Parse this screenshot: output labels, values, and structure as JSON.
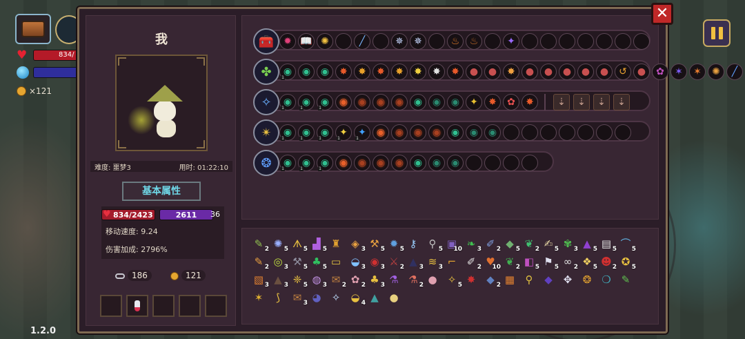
{
  "hud": {
    "hp_text": "834/",
    "coin_count": "×121",
    "version": "1.2.0"
  },
  "character": {
    "name": "我",
    "difficulty": "难度: 噩梦3",
    "time": "用时: 01:22:10",
    "attributes_button": "基本属性",
    "hp": "834/2423",
    "mp": "2611",
    "mp_extra": "36",
    "move_speed": "移动速度: 9.24",
    "damage_bonus": "伤害加成: 2796%",
    "keys": "186",
    "coins": "121"
  },
  "close_label": "✕",
  "colors": {
    "hp": "#a41c2c",
    "mp": "#6a2aa6",
    "panel": "#2b1d28",
    "accent": "#6fd8e8"
  },
  "rows": [
    {
      "icon": "chest-icon",
      "glyph": "🧰",
      "skills": [
        {
          "g": "✹",
          "c": "#e0407a"
        },
        {
          "g": "📖",
          "c": "#9ab8ff"
        },
        {
          "g": "✺",
          "c": "#f0c040"
        },
        {
          "g": "",
          "c": ""
        },
        {
          "g": "╱",
          "c": "#7ab8ff"
        },
        {
          "g": "",
          "c": ""
        },
        {
          "g": "✵",
          "c": "#c8d8ff"
        },
        {
          "g": "✵",
          "c": "#c8d8ff"
        },
        {
          "g": "",
          "c": ""
        },
        {
          "g": "♨",
          "c": "#e8802a"
        },
        {
          "g": "♨",
          "c": "#c8702a"
        },
        {
          "g": "",
          "c": ""
        },
        {
          "g": "✦",
          "c": "#9a6aff"
        },
        {
          "g": "",
          "c": ""
        },
        {
          "g": "",
          "c": ""
        },
        {
          "g": "",
          "c": ""
        },
        {
          "g": "",
          "c": ""
        },
        {
          "g": "",
          "c": ""
        },
        {
          "g": "",
          "c": ""
        },
        {
          "g": "",
          "c": ""
        }
      ]
    },
    {
      "icon": "staff-green-icon",
      "glyph": "✤",
      "skills": [
        {
          "g": "◉",
          "c": "#30c090",
          "lv": "1"
        },
        {
          "g": "◉",
          "c": "#30c090"
        },
        {
          "g": "◉",
          "c": "#30c090"
        },
        {
          "g": "✸",
          "c": "#e85a2a"
        },
        {
          "g": "✸",
          "c": "#e8a02a"
        },
        {
          "g": "✸",
          "c": "#e85a2a"
        },
        {
          "g": "✸",
          "c": "#e8a02a"
        },
        {
          "g": "✸",
          "c": "#f0d040"
        },
        {
          "g": "✸",
          "c": "#e0e0e0"
        },
        {
          "g": "✸",
          "c": "#e85a2a"
        },
        {
          "g": "●",
          "c": "#c85050"
        },
        {
          "g": "●",
          "c": "#c85050"
        },
        {
          "g": "✸",
          "c": "#f0a040"
        },
        {
          "g": "●",
          "c": "#c85050"
        },
        {
          "g": "●",
          "c": "#c85050"
        },
        {
          "g": "●",
          "c": "#c85050"
        },
        {
          "g": "●",
          "c": "#c85050"
        },
        {
          "g": "●",
          "c": "#c85050"
        },
        {
          "g": "↺",
          "c": "#e8a030"
        },
        {
          "g": "●",
          "c": "#c85050"
        },
        {
          "g": "✿",
          "c": "#c050c0"
        },
        {
          "g": "✶",
          "c": "#8060ff"
        },
        {
          "g": "✶",
          "c": "#f08030"
        },
        {
          "g": "✺",
          "c": "#e8a040"
        },
        {
          "g": "╱",
          "c": "#60a0ff"
        }
      ]
    },
    {
      "icon": "staff-blue-icon",
      "glyph": "✧",
      "skills": [
        {
          "g": "◉",
          "c": "#30c090",
          "lv": "1"
        },
        {
          "g": "◉",
          "c": "#30c090",
          "lv": "1"
        },
        {
          "g": "◉",
          "c": "#30c090",
          "lv": "1"
        },
        {
          "g": "((•))",
          "c": "#e8602a"
        },
        {
          "g": "((•))",
          "c": "#a84020"
        },
        {
          "g": "((•))",
          "c": "#a84020"
        },
        {
          "g": "((•))",
          "c": "#a84020"
        },
        {
          "g": "◉",
          "c": "#30c090"
        },
        {
          "g": "◉",
          "c": "#2a8a70"
        },
        {
          "g": "◉",
          "c": "#2a8a70"
        },
        {
          "g": "✦",
          "c": "#e8c030"
        },
        {
          "g": "✸",
          "c": "#e85a2a"
        },
        {
          "g": "✿",
          "c": "#e85050"
        },
        {
          "g": "✸",
          "c": "#e85a2a"
        },
        {
          "sep": true
        },
        {
          "g": "⇣",
          "c": "#c8a090",
          "sq": true
        },
        {
          "g": "⇣",
          "c": "#c8a090",
          "sq": true
        },
        {
          "g": "⇣",
          "c": "#c8a090",
          "sq": true
        },
        {
          "g": "⇣",
          "c": "#c8a090",
          "sq": true
        }
      ]
    },
    {
      "icon": "staff-gold-icon",
      "glyph": "✴",
      "skills": [
        {
          "g": "◉",
          "c": "#30c090",
          "lv": "1"
        },
        {
          "g": "◉",
          "c": "#30c090",
          "lv": "1"
        },
        {
          "g": "◉",
          "c": "#30c090",
          "lv": "1"
        },
        {
          "g": "✦",
          "c": "#f0d040",
          "lv": "1"
        },
        {
          "g": "✦",
          "c": "#40a0ff",
          "lv": "1"
        },
        {
          "g": "((•))",
          "c": "#e8602a"
        },
        {
          "g": "((•))",
          "c": "#a84020"
        },
        {
          "g": "((•))",
          "c": "#a84020"
        },
        {
          "g": "((•))",
          "c": "#a84020"
        },
        {
          "g": "◉",
          "c": "#30c090"
        },
        {
          "g": "◉",
          "c": "#2a8a70"
        },
        {
          "g": "◉",
          "c": "#2a8a70"
        },
        {
          "g": "",
          "c": ""
        },
        {
          "g": "",
          "c": ""
        },
        {
          "g": "",
          "c": ""
        },
        {
          "g": "",
          "c": ""
        },
        {
          "g": "",
          "c": ""
        },
        {
          "g": "",
          "c": ""
        },
        {
          "g": "",
          "c": ""
        }
      ]
    },
    {
      "icon": "orb-blue-icon",
      "glyph": "❂",
      "skills": [
        {
          "g": "◉",
          "c": "#30c090",
          "lv": "1"
        },
        {
          "g": "◉",
          "c": "#30c090",
          "lv": "1"
        },
        {
          "g": "◉",
          "c": "#30c090",
          "lv": "1"
        },
        {
          "g": "((•))",
          "c": "#e8602a"
        },
        {
          "g": "((•))",
          "c": "#a84020"
        },
        {
          "g": "((•))",
          "c": "#a84020"
        },
        {
          "g": "((•))",
          "c": "#a84020"
        },
        {
          "g": "◉",
          "c": "#30c090"
        },
        {
          "g": "◉",
          "c": "#2a8a70"
        },
        {
          "g": "◉",
          "c": "#2a8a70"
        },
        {
          "g": "",
          "c": ""
        },
        {
          "g": "",
          "c": ""
        },
        {
          "g": "",
          "c": ""
        },
        {
          "g": "",
          "c": ""
        }
      ]
    }
  ],
  "row_widths": [
    576,
    576,
    576,
    576,
    436
  ],
  "inventory": [
    {
      "g": "✎",
      "c": "#90c050",
      "n": "2"
    },
    {
      "g": "✺",
      "c": "#9ab0ff",
      "n": "5"
    },
    {
      "g": "ᗑ",
      "c": "#e8c040",
      "n": "5"
    },
    {
      "g": "▟",
      "c": "#b060e0",
      "n": "5"
    },
    {
      "g": "♜",
      "c": "#e0a030",
      "n": ""
    },
    {
      "g": "◈",
      "c": "#e8a040",
      "n": "3"
    },
    {
      "g": "⚒",
      "c": "#e8a040",
      "n": "5"
    },
    {
      "g": "✹",
      "c": "#60a0e0",
      "n": "5"
    },
    {
      "g": "⚷",
      "c": "#9ad0ff",
      "n": ""
    },
    {
      "g": "⚲",
      "c": "#c0c0c0",
      "n": "5"
    },
    {
      "g": "▣",
      "c": "#8060c0",
      "n": "10"
    },
    {
      "g": "❧",
      "c": "#40c050",
      "n": "3"
    },
    {
      "g": "✐",
      "c": "#80a0e0",
      "n": "2"
    },
    {
      "g": "◆",
      "c": "#70b070",
      "n": "5"
    },
    {
      "g": "❦",
      "c": "#40c070",
      "n": "2"
    },
    {
      "g": "✍",
      "c": "#e0d0a0",
      "n": "5"
    },
    {
      "g": "✾",
      "c": "#50c050",
      "n": "3"
    },
    {
      "g": "▲",
      "c": "#9040d0",
      "n": "5"
    },
    {
      "g": "▤",
      "c": "#e0e0e0",
      "n": "5"
    },
    {
      "g": "⌒",
      "c": "#60b0e0",
      "n": "5"
    },
    {
      "g": "✎",
      "c": "#e8a040",
      "n": "2"
    },
    {
      "g": "◎",
      "c": "#c0e040",
      "n": "3"
    },
    {
      "g": "⚒",
      "c": "#9090a0",
      "n": "5"
    },
    {
      "g": "♣",
      "c": "#30c060",
      "n": "5"
    },
    {
      "g": "▭",
      "c": "#e0c040",
      "n": ""
    },
    {
      "g": "◒",
      "c": "#80c0ff",
      "n": "3"
    },
    {
      "g": "◉",
      "c": "#d03030",
      "n": "3"
    },
    {
      "g": "⚔",
      "c": "#c04040",
      "n": "2"
    },
    {
      "g": "▲",
      "c": "#303060",
      "n": "3"
    },
    {
      "g": "≋",
      "c": "#e8c040",
      "n": "3"
    },
    {
      "g": "⌐",
      "c": "#e0a030",
      "n": ""
    },
    {
      "g": "✐",
      "c": "#e0e0e0",
      "n": "2"
    },
    {
      "g": "♥",
      "c": "#e07030",
      "n": "10"
    },
    {
      "g": "❦",
      "c": "#40b050",
      "n": "2"
    },
    {
      "g": "◧",
      "c": "#c050c0",
      "n": "5"
    },
    {
      "g": "⚑",
      "c": "#e0e0f0",
      "n": "5"
    },
    {
      "g": "∞",
      "c": "#e0e0e0",
      "n": "2"
    },
    {
      "g": "❖",
      "c": "#f0d060",
      "n": "5"
    },
    {
      "g": "☻",
      "c": "#d03030",
      "n": "2"
    },
    {
      "g": "✪",
      "c": "#e8c040",
      "n": "5"
    },
    {
      "g": "▧",
      "c": "#e08030",
      "n": "3"
    },
    {
      "g": "▲",
      "c": "#6a5040",
      "n": "3"
    },
    {
      "g": "❈",
      "c": "#e8c040",
      "n": "5"
    },
    {
      "g": "◍",
      "c": "#c090e0",
      "n": "3"
    },
    {
      "g": "✉",
      "c": "#c08040",
      "n": "2"
    },
    {
      "g": "✿",
      "c": "#e0a0b0",
      "n": "2"
    },
    {
      "g": "♣",
      "c": "#e8c040",
      "n": "3"
    },
    {
      "g": "⚗",
      "c": "#a060e0",
      "n": ""
    },
    {
      "g": "⚗",
      "c": "#e07060",
      "n": "2"
    },
    {
      "g": "●",
      "c": "#e0a0b0",
      "n": ""
    },
    {
      "g": "✧",
      "c": "#e8c040",
      "n": "5"
    },
    {
      "g": "✸",
      "c": "#d03030",
      "n": ""
    },
    {
      "g": "◆",
      "c": "#6080c0",
      "n": "2"
    },
    {
      "g": "▦",
      "c": "#e08030",
      "n": ""
    },
    {
      "g": "⚲",
      "c": "#e0c040",
      "n": ""
    },
    {
      "g": "◆",
      "c": "#6040c0",
      "n": ""
    },
    {
      "g": "✥",
      "c": "#e0e0f0",
      "n": ""
    },
    {
      "g": "❂",
      "c": "#e0a030",
      "n": ""
    },
    {
      "g": "❍",
      "c": "#40b0c0",
      "n": ""
    },
    {
      "g": "✎",
      "c": "#60c050",
      "n": ""
    },
    {
      "g": "✶",
      "c": "#e0b030",
      "n": ""
    },
    {
      "g": "⟆",
      "c": "#e8c040",
      "n": ""
    },
    {
      "g": "✉",
      "c": "#c08040",
      "n": "3"
    },
    {
      "g": "◕",
      "c": "#6060c0",
      "n": ""
    },
    {
      "g": "✧",
      "c": "#c0e0ff",
      "n": ""
    },
    {
      "g": "◒",
      "c": "#e8c040",
      "n": "4"
    },
    {
      "g": "▲",
      "c": "#40a0a0",
      "n": ""
    },
    {
      "g": "●",
      "c": "#e8d080",
      "n": ""
    }
  ]
}
